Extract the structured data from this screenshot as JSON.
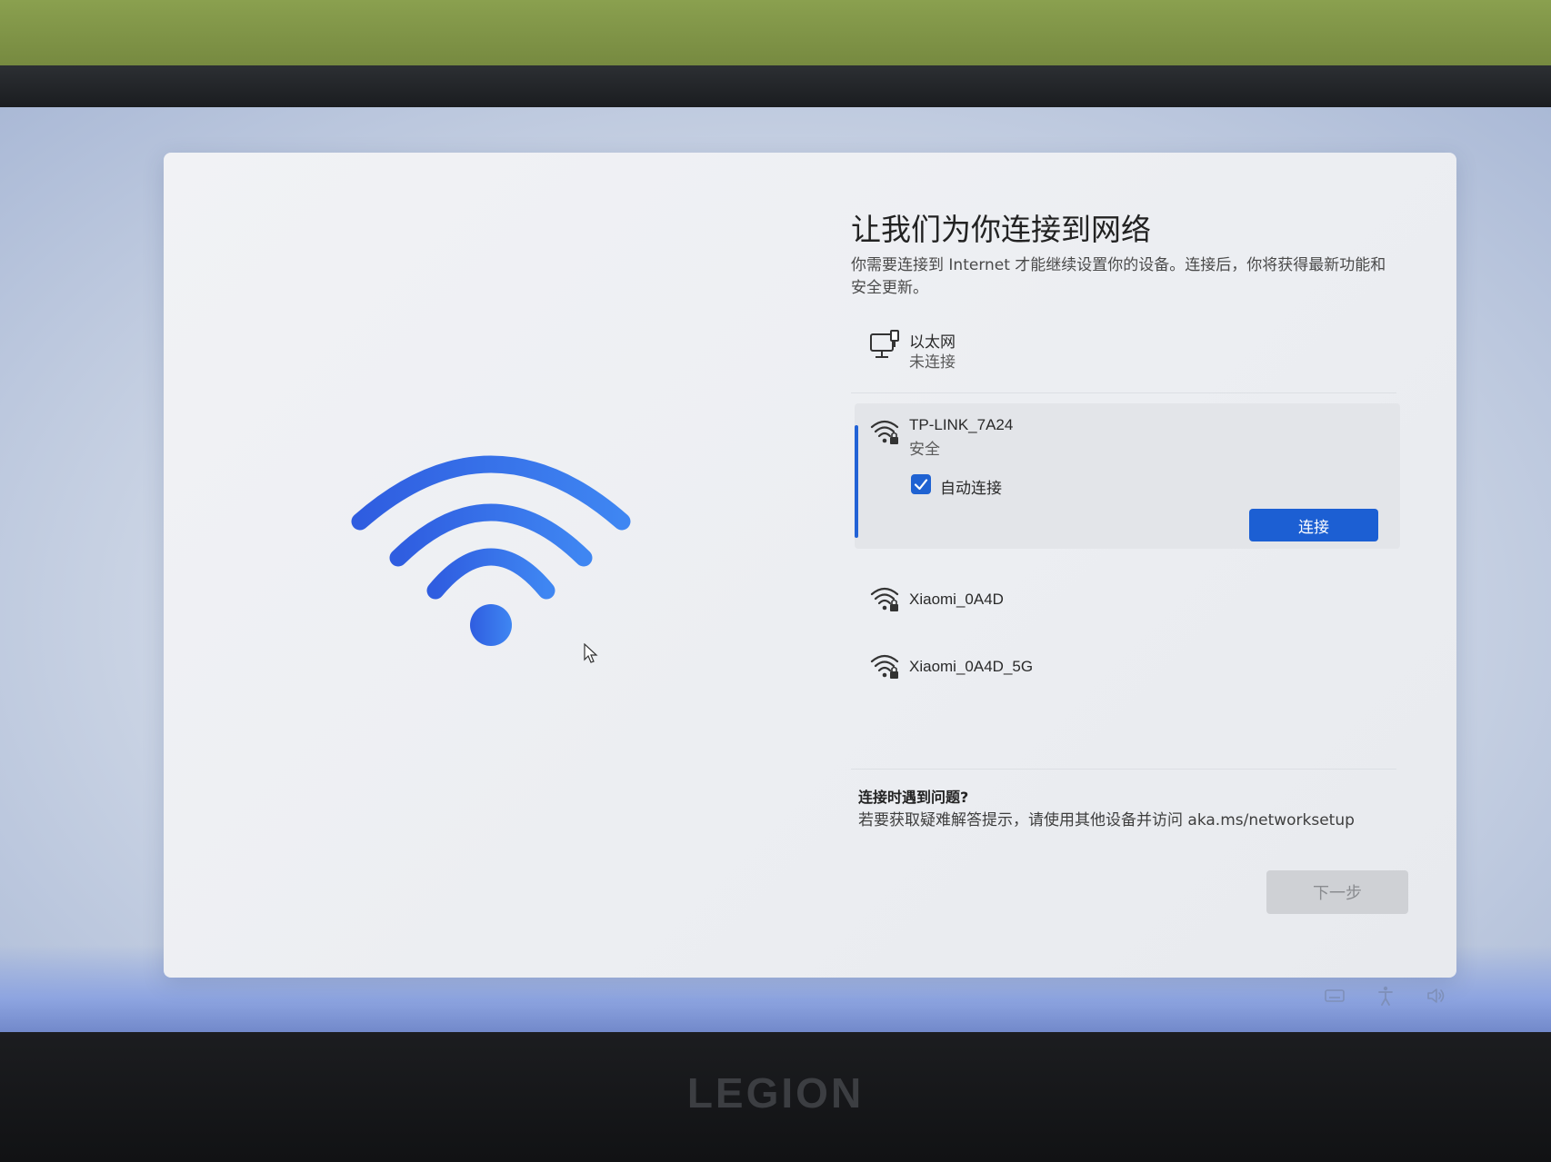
{
  "page": {
    "title": "让我们为你连接到网络",
    "description": "你需要连接到 Internet 才能继续设置你的设备。连接后，你将获得最新功能和安全更新。"
  },
  "networks": {
    "ethernet": {
      "name": "以太网",
      "status": "未连接",
      "icon": "ethernet-icon"
    },
    "selected": {
      "name": "TP-LINK_7A24",
      "status": "安全",
      "icon": "wifi-lock-icon",
      "auto_connect_label": "自动连接",
      "auto_connect_checked": true,
      "connect_label": "连接"
    },
    "others": [
      {
        "name": "Xiaomi_0A4D",
        "icon": "wifi-lock-icon"
      },
      {
        "name": "Xiaomi_0A4D_5G",
        "icon": "wifi-lock-icon"
      }
    ]
  },
  "help": {
    "title": "连接时遇到问题?",
    "text": "若要获取疑难解答提示，请使用其他设备并访问 aka.ms/networksetup"
  },
  "footer": {
    "next_label": "下一步"
  },
  "device": {
    "brand": "LEGION"
  },
  "colors": {
    "accent": "#1c5fd3",
    "wifi_hero": "#2f6ae6"
  }
}
